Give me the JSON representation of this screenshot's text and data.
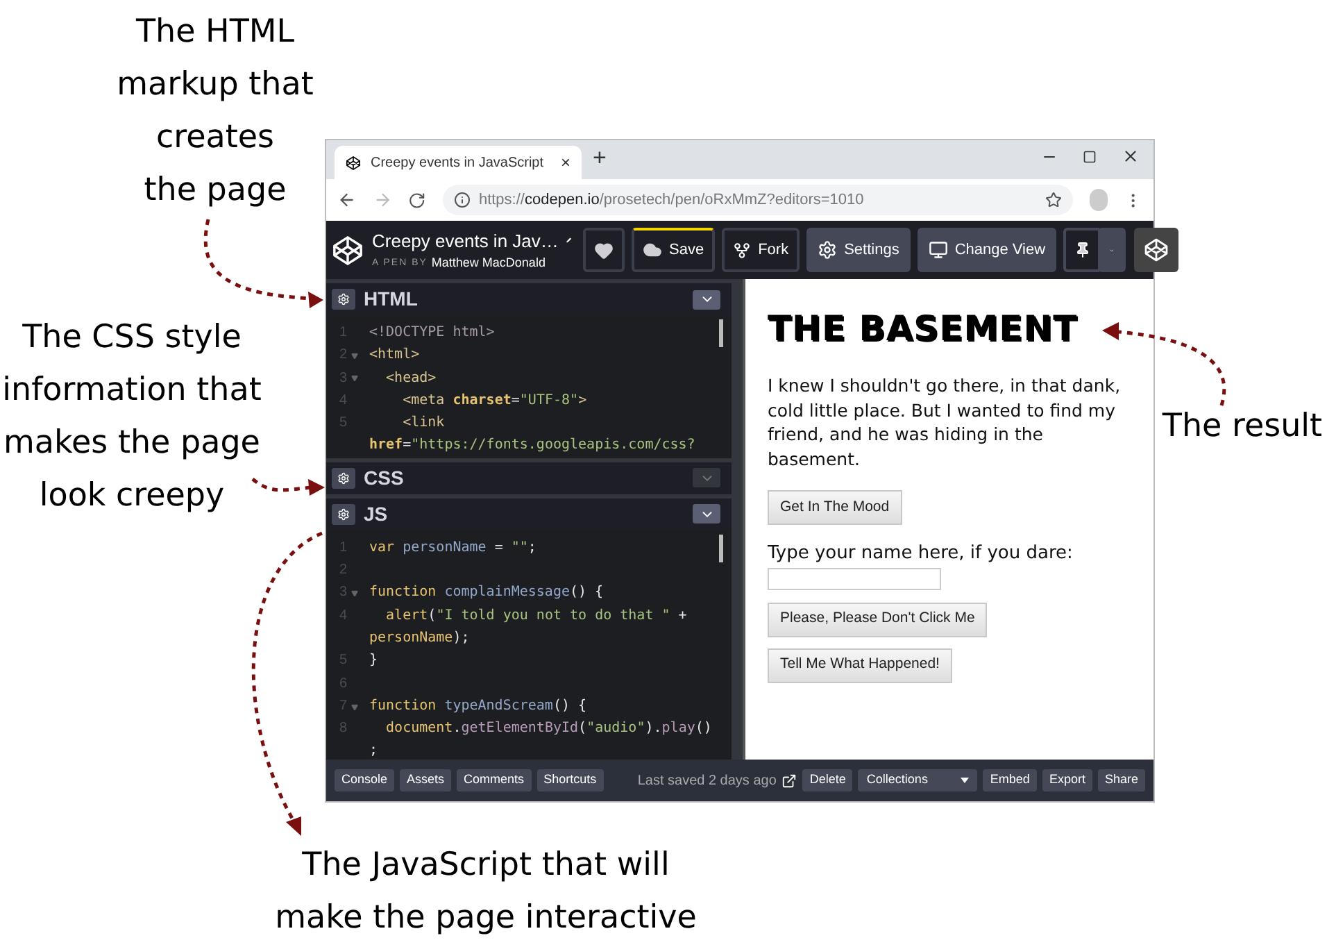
{
  "callouts": [
    {
      "kind": "html",
      "text": "The HTML\nmarkup that\ncreates\nthe page"
    },
    {
      "kind": "css",
      "text": "The CSS style\ninformation that\nmakes the page\nlook creepy"
    },
    {
      "kind": "result",
      "text": "The result"
    },
    {
      "kind": "js",
      "text": "The JavaScript that will\nmake the page interactive"
    }
  ],
  "browser": {
    "tab": {
      "title": "Creepy events in JavaScript",
      "close": "×"
    },
    "new_tab": "+",
    "url": {
      "scheme": "https://",
      "host": "codepen.io",
      "path": "/prosetech/pen/oRxMmZ?editors=1010"
    }
  },
  "header": {
    "title": "Creepy events in Jav…",
    "byline_prefix": "A PEN BY",
    "author": "Matthew MacDonald",
    "buttons": [
      {
        "kind": "heart"
      },
      {
        "kind": "save",
        "label": "Save"
      },
      {
        "kind": "fork",
        "label": "Fork"
      },
      {
        "kind": "settings",
        "label": "Settings"
      },
      {
        "kind": "view",
        "label": "Change View"
      },
      {
        "kind": "pin"
      },
      {
        "kind": "caret"
      }
    ]
  },
  "editors": [
    {
      "title": "HTML",
      "expanded": true,
      "lines": [
        {
          "number": "1",
          "fold": false,
          "tokens": [
            {
              "text": "<!DOCTYPE html>",
              "kind": "doctype"
            }
          ]
        },
        {
          "number": "2",
          "fold": true,
          "tokens": [
            {
              "text": "<html>",
              "kind": "tag"
            }
          ]
        },
        {
          "number": "3",
          "fold": true,
          "tokens": [
            {
              "text": "  <head>",
              "kind": "tag"
            }
          ]
        },
        {
          "number": "4",
          "fold": false,
          "tokens": [
            {
              "text": "    <meta ",
              "kind": "tag"
            },
            {
              "text": "charset",
              "kind": "attr"
            },
            {
              "text": "=",
              "kind": "punct"
            },
            {
              "text": "\"UTF-8\"",
              "kind": "string"
            },
            {
              "text": ">",
              "kind": "tag"
            }
          ]
        },
        {
          "number": "5",
          "fold": false,
          "tokens": [
            {
              "text": "    <link",
              "kind": "tag"
            }
          ]
        },
        {
          "tokens": [
            {
              "text": "href",
              "kind": "attr"
            },
            {
              "text": "=",
              "kind": "punct"
            },
            {
              "text": "\"https://fonts.googleapis.com/css?",
              "kind": "string"
            }
          ]
        }
      ]
    },
    {
      "title": "CSS",
      "expanded": false
    },
    {
      "title": "JS",
      "expanded": true,
      "lines": [
        {
          "number": "1",
          "fold": false,
          "tokens": [
            {
              "text": "var ",
              "kind": "keyword"
            },
            {
              "text": "personName",
              "kind": "name"
            },
            {
              "text": " = ",
              "kind": "punct"
            },
            {
              "text": "\"\"",
              "kind": "string"
            },
            {
              "text": ";",
              "kind": "punct"
            }
          ]
        },
        {
          "number": "2",
          "fold": false
        },
        {
          "number": "3",
          "fold": true,
          "tokens": [
            {
              "text": "function ",
              "kind": "keyword"
            },
            {
              "text": "complainMessage",
              "kind": "name"
            },
            {
              "text": "() {",
              "kind": "punct"
            }
          ]
        },
        {
          "number": "4",
          "fold": false,
          "tokens": [
            {
              "text": "  alert",
              "kind": "call"
            },
            {
              "text": "(",
              "kind": "punct"
            },
            {
              "text": "\"I told you not to do that \"",
              "kind": "string"
            },
            {
              "text": " +",
              "kind": "punct"
            }
          ]
        },
        {
          "tokens": [
            {
              "text": "personName",
              "kind": "call"
            },
            {
              "text": ");",
              "kind": "punct"
            }
          ]
        },
        {
          "number": "5",
          "fold": false,
          "tokens": [
            {
              "text": "}",
              "kind": "punct"
            }
          ]
        },
        {
          "number": "6",
          "fold": false
        },
        {
          "number": "7",
          "fold": true,
          "tokens": [
            {
              "text": "function ",
              "kind": "keyword"
            },
            {
              "text": "typeAndScream",
              "kind": "name"
            },
            {
              "text": "() {",
              "kind": "punct"
            }
          ]
        },
        {
          "number": "8",
          "fold": false,
          "tokens": [
            {
              "text": "  document",
              "kind": "call"
            },
            {
              "text": ".",
              "kind": "punct"
            },
            {
              "text": "getElementById",
              "kind": "method"
            },
            {
              "text": "(",
              "kind": "punct"
            },
            {
              "text": "\"audio\"",
              "kind": "string"
            },
            {
              "text": ").",
              "kind": "punct"
            },
            {
              "text": "play",
              "kind": "method"
            },
            {
              "text": "()",
              "kind": "punct"
            }
          ]
        },
        {
          "tokens": [
            {
              "text": ";",
              "kind": "punct"
            }
          ]
        }
      ]
    }
  ],
  "result": {
    "heading": "THE BASEMENT",
    "paragraph": "I knew I shouldn't go there, in that dank, cold little place. But I wanted to find my friend, and he was hiding in the basement.",
    "items": [
      {
        "kind": "button",
        "label": "Get In The Mood"
      },
      {
        "kind": "label",
        "label": "Type your name here, if you dare:"
      },
      {
        "kind": "input"
      },
      {
        "kind": "button",
        "label": "Please, Please Don't Click Me"
      },
      {
        "kind": "button",
        "label": "Tell Me What Happened!"
      }
    ]
  },
  "footer": {
    "left_buttons": [
      "Console",
      "Assets",
      "Comments",
      "Shortcuts"
    ],
    "status": "Last saved 2 days ago",
    "right_buttons": [
      {
        "kind": "plain",
        "label": "Delete"
      },
      {
        "kind": "dropdown",
        "label": "Collections"
      },
      {
        "kind": "plain",
        "label": "Embed"
      },
      {
        "kind": "plain",
        "label": "Export"
      },
      {
        "kind": "plain",
        "label": "Share"
      }
    ]
  }
}
